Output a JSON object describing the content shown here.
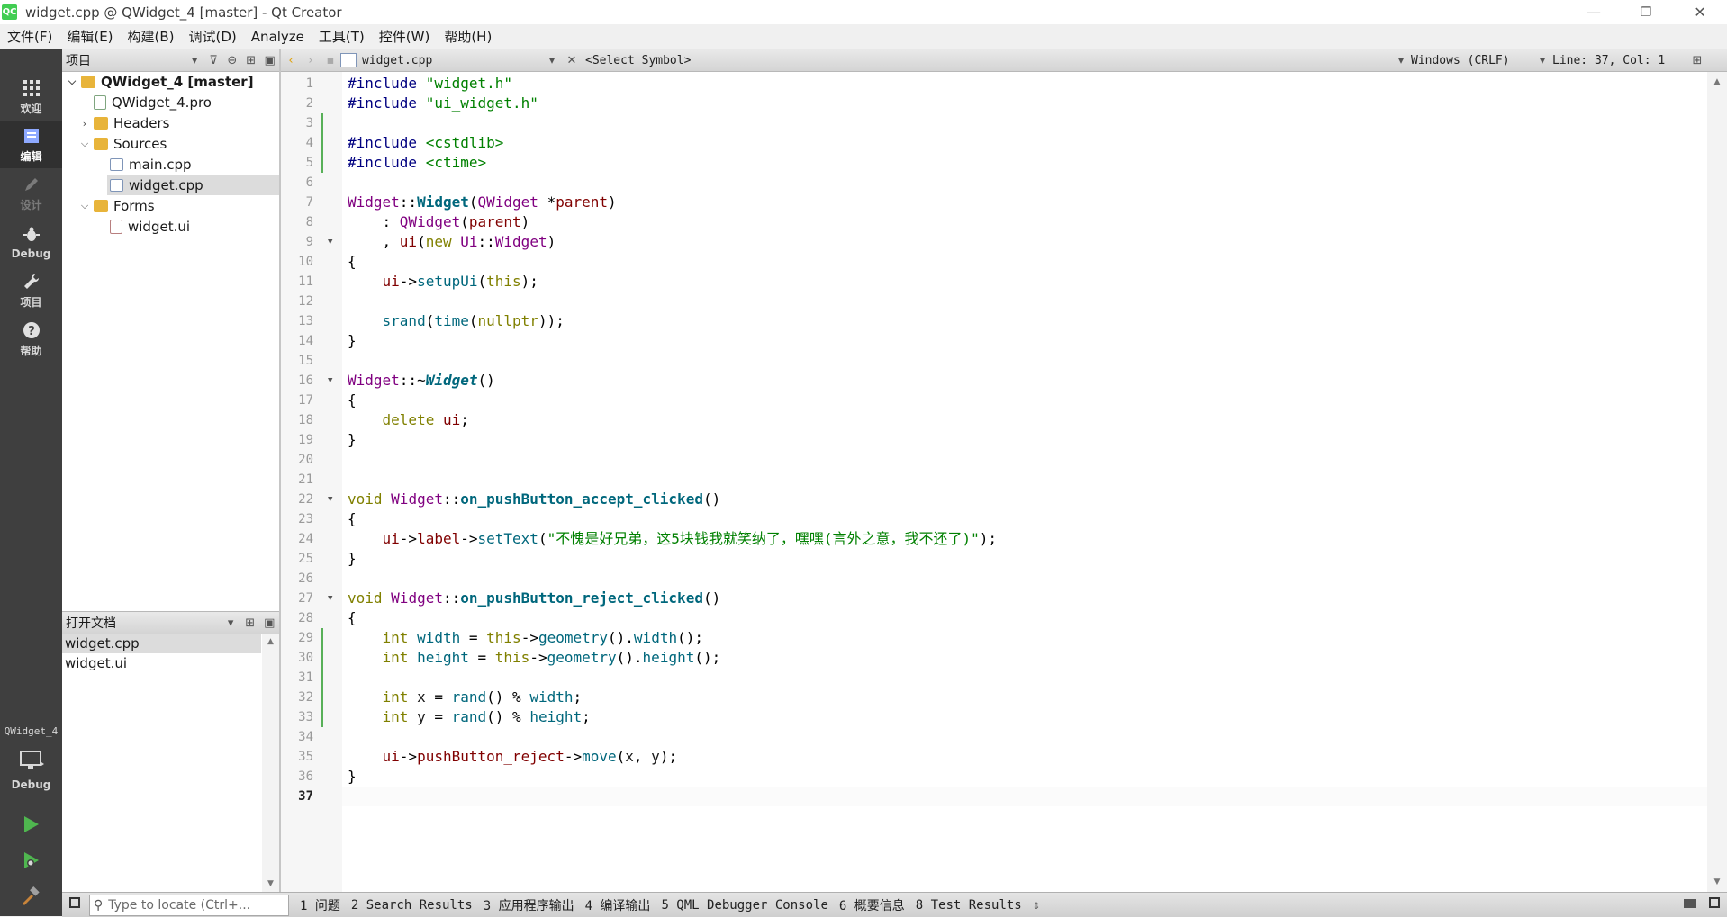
{
  "window": {
    "title": "widget.cpp @ QWidget_4 [master] - Qt Creator",
    "app_icon": "QC",
    "minimize": "—",
    "maximize": "❐",
    "close": "✕"
  },
  "menubar": [
    "文件(F)",
    "编辑(E)",
    "构建(B)",
    "调试(D)",
    "Analyze",
    "工具(T)",
    "控件(W)",
    "帮助(H)"
  ],
  "modes": [
    {
      "label": "欢迎",
      "icon": "welcome-grid-icon"
    },
    {
      "label": "编辑",
      "icon": "edit-document-icon",
      "active": true
    },
    {
      "label": "设计",
      "icon": "design-pen-icon",
      "disabled": true
    },
    {
      "label": "Debug",
      "icon": "debug-bug-icon"
    },
    {
      "label": "项目",
      "icon": "wrench-icon"
    },
    {
      "label": "帮助",
      "icon": "help-question-icon"
    }
  ],
  "kit_selector": {
    "project": "QWidget_4",
    "config": "Debug",
    "icon": "monitor-icon"
  },
  "run_buttons": {
    "run": "run-icon",
    "debug_run": "debug-run-icon",
    "build": "hammer-icon"
  },
  "project_pane": {
    "header": "项目",
    "tree": [
      {
        "label": "QWidget_4 [master]",
        "level": 0,
        "expanded": true,
        "kind": "project"
      },
      {
        "label": "QWidget_4.pro",
        "level": 1,
        "kind": "pro"
      },
      {
        "label": "Headers",
        "level": 1,
        "expanded": false,
        "kind": "folder"
      },
      {
        "label": "Sources",
        "level": 1,
        "expanded": true,
        "kind": "folder"
      },
      {
        "label": "main.cpp",
        "level": 2,
        "kind": "cpp"
      },
      {
        "label": "widget.cpp",
        "level": 2,
        "kind": "cpp",
        "selected": true
      },
      {
        "label": "Forms",
        "level": 1,
        "expanded": true,
        "kind": "folder"
      },
      {
        "label": "widget.ui",
        "level": 2,
        "kind": "ui"
      }
    ]
  },
  "open_docs": {
    "header": "打开文档",
    "items": [
      {
        "label": "widget.cpp",
        "selected": true
      },
      {
        "label": "widget.ui"
      }
    ]
  },
  "editor_toolbar": {
    "file": "widget.cpp",
    "symbol": "<Select Symbol>",
    "line_ending": "Windows (CRLF)",
    "position": "Line: 37, Col: 1"
  },
  "editor": {
    "current_line": 37,
    "fold_lines": [
      9,
      16,
      22,
      27
    ],
    "changed_lines": [
      3,
      4,
      5,
      29,
      30,
      31,
      32,
      33
    ],
    "lines": [
      "#include \"widget.h\"",
      "#include \"ui_widget.h\"",
      "",
      "#include <cstdlib>",
      "#include <ctime>",
      "",
      "Widget::Widget(QWidget *parent)",
      "    : QWidget(parent)",
      "    , ui(new Ui::Widget)",
      "{",
      "    ui->setupUi(this);",
      "",
      "    srand(time(nullptr));",
      "}",
      "",
      "Widget::~Widget()",
      "{",
      "    delete ui;",
      "}",
      "",
      "",
      "void Widget::on_pushButton_accept_clicked()",
      "{",
      "    ui->label->setText(\"不愧是好兄弟，这5块钱我就笑纳了，嘿嘿(言外之意，我不还了)\");",
      "}",
      "",
      "void Widget::on_pushButton_reject_clicked()",
      "{",
      "    int width = this->geometry().width();",
      "    int height = this->geometry().height();",
      "",
      "    int x = rand() % width;",
      "    int y = rand() % height;",
      "",
      "    ui->pushButton_reject->move(x, y);",
      "}",
      ""
    ]
  },
  "statusbar": {
    "locator_placeholder": "Type to locate (Ctrl+...",
    "tabs": [
      "1 问题",
      "2 Search Results",
      "3 应用程序输出",
      "4 编译输出",
      "5 QML Debugger Console",
      "6 概要信息",
      "8 Test Results"
    ]
  }
}
